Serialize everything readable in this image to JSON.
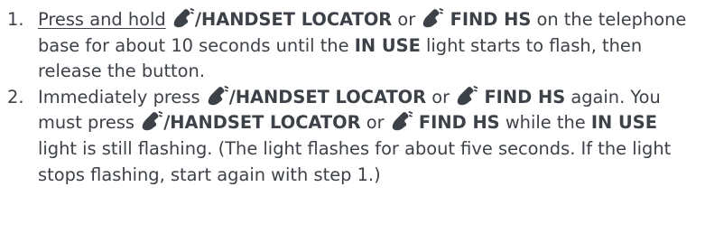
{
  "steps": [
    {
      "number": "1.",
      "press_hold": "Press and hold",
      "sep": "/",
      "locator": "HANDSET LOCATOR",
      "or": " or ",
      "find_hs": "FIND HS",
      "t1": " on the telephone base for about 10 seconds until the ",
      "in_use": "IN USE",
      "t2": " light starts to flash, then release the button.",
      "icon": "handset-icon"
    },
    {
      "number": "2.",
      "t0": "Immediately press ",
      "sep": "/",
      "locator": "HANDSET LOCATOR",
      "or": " or ",
      "find_hs": "FIND HS",
      "t1": " again. You must press ",
      "t2": " while the ",
      "in_use": "IN USE",
      "t3": " light is still flashing. (The light flashes for about five seconds. If the light stops flashing, start again with step 1.)",
      "icon": "handset-icon"
    }
  ],
  "colors": {
    "text": "#3d4148",
    "icon": "#3d4148"
  }
}
